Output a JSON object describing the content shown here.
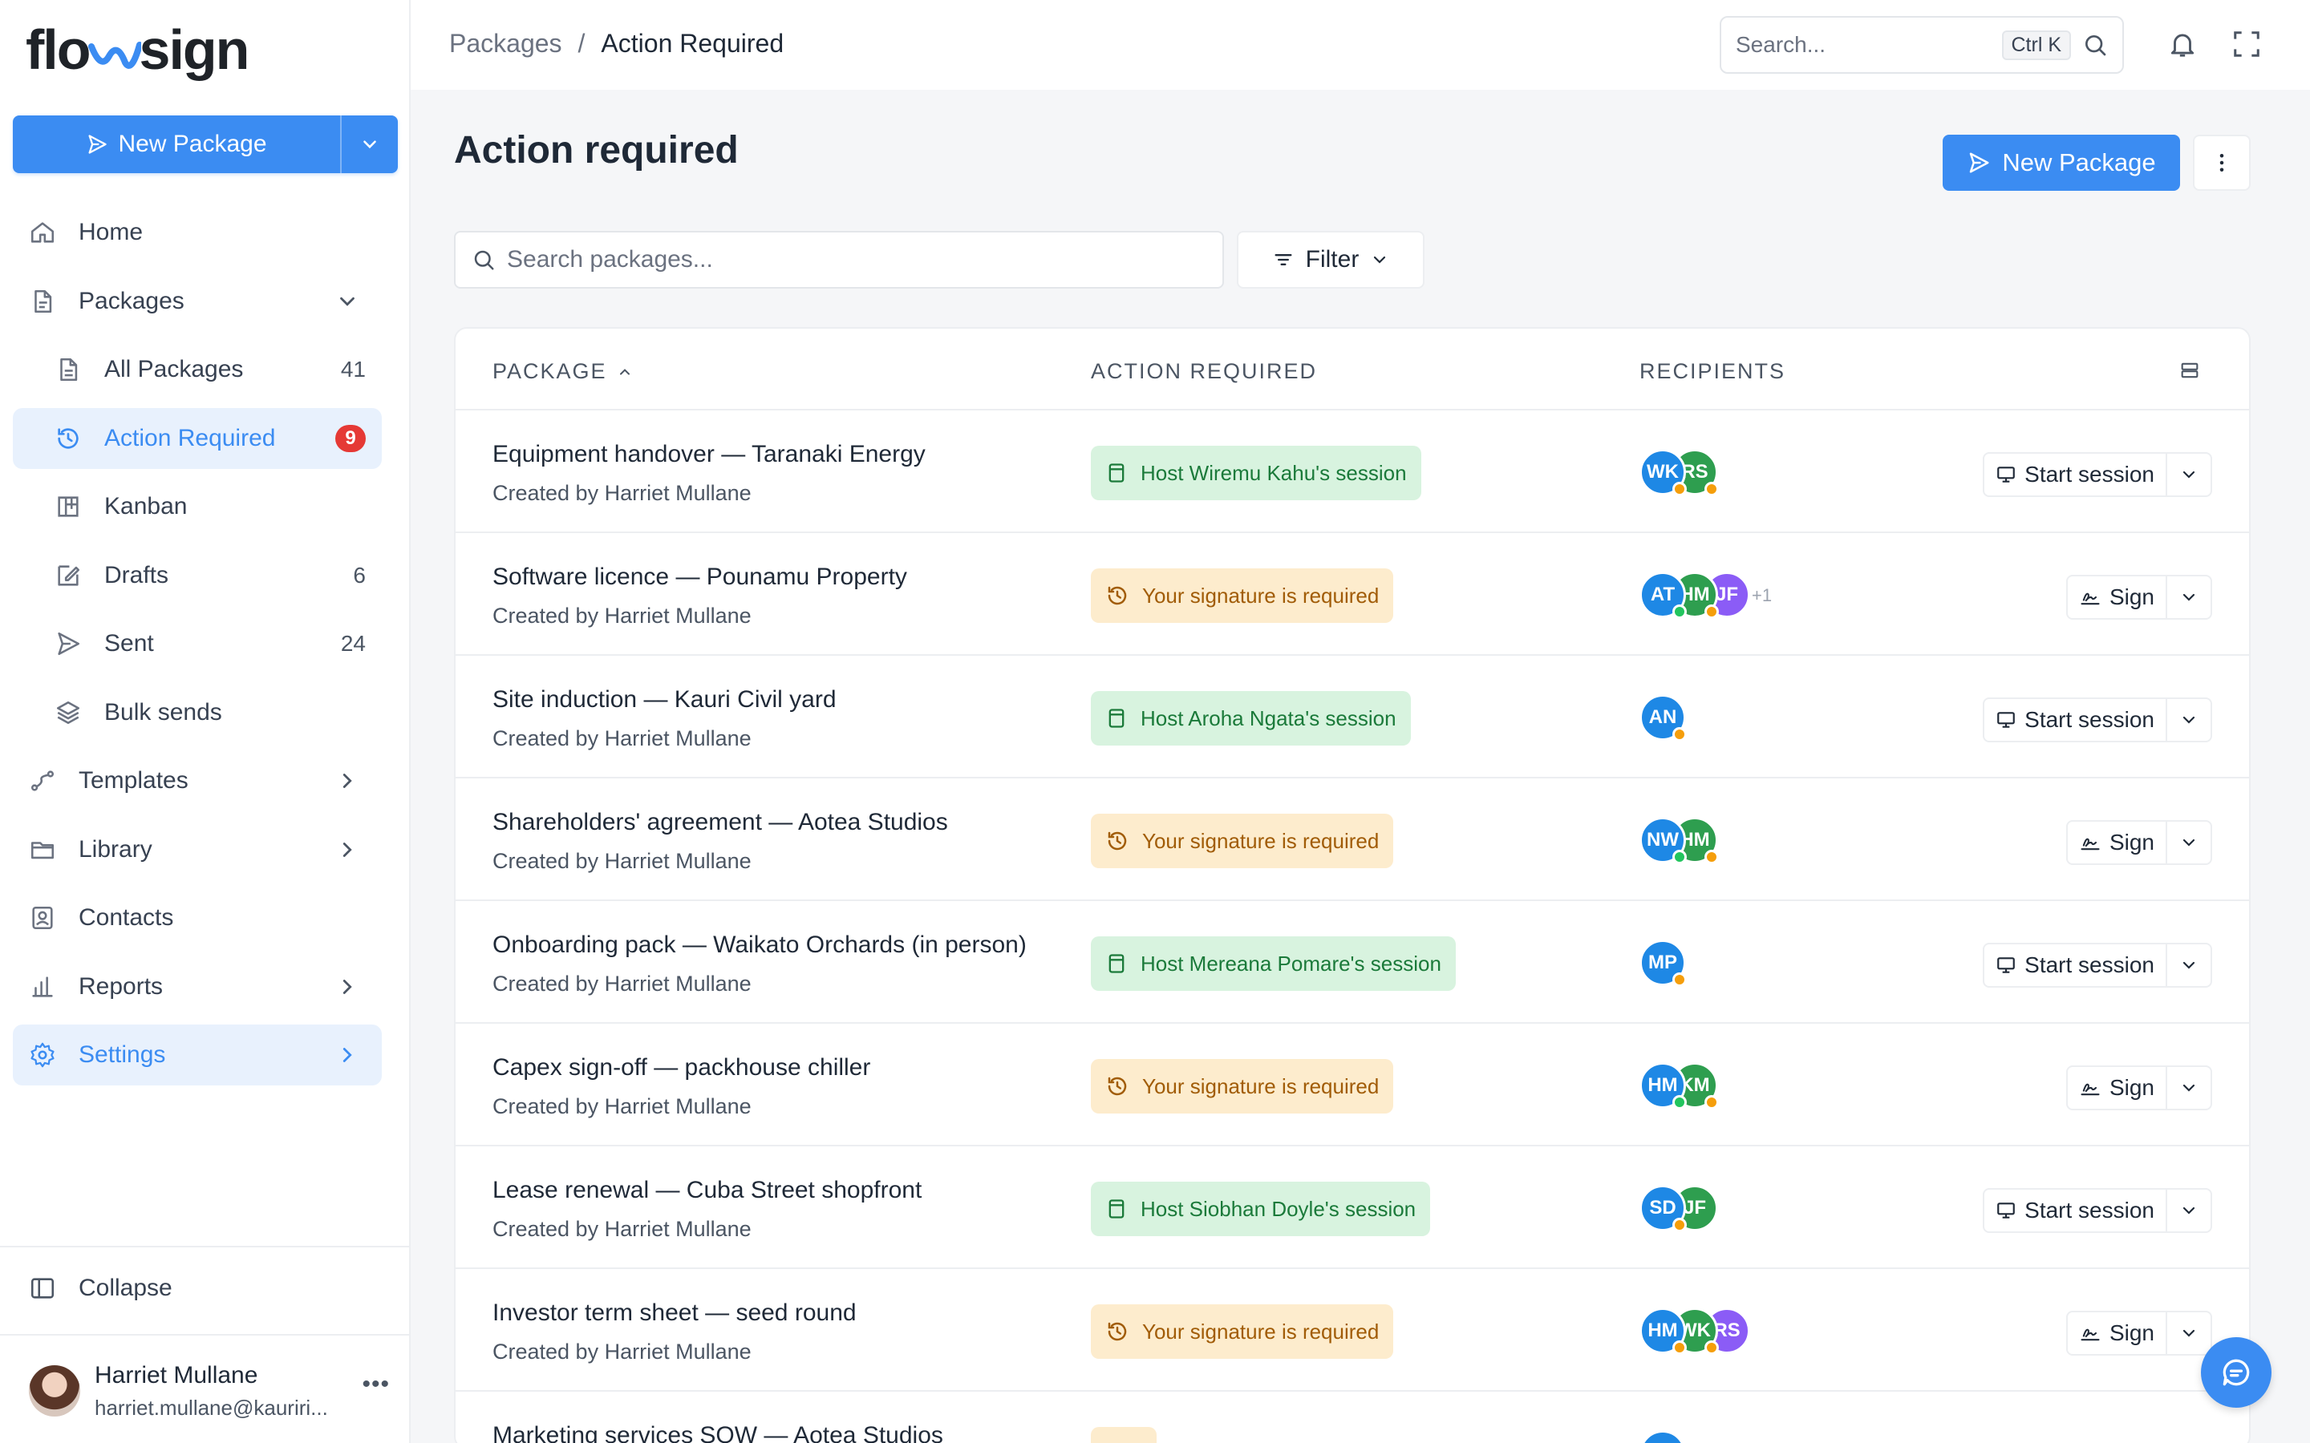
{
  "app": {
    "brand_left": "flo",
    "brand_right": "sign"
  },
  "sidebar": {
    "new_package_label": "New Package",
    "items": [
      {
        "label": "Home",
        "icon": "home-icon"
      },
      {
        "label": "Packages",
        "icon": "document-icon"
      },
      {
        "label": "All Packages",
        "icon": "file-icon",
        "count": "41"
      },
      {
        "label": "Action Required",
        "icon": "history-icon",
        "badge": "9"
      },
      {
        "label": "Kanban",
        "icon": "kanban-icon"
      },
      {
        "label": "Drafts",
        "icon": "edit-icon",
        "count": "6"
      },
      {
        "label": "Sent",
        "icon": "send-icon",
        "count": "24"
      },
      {
        "label": "Bulk sends",
        "icon": "layers-icon"
      },
      {
        "label": "Templates",
        "icon": "route-icon"
      },
      {
        "label": "Library",
        "icon": "folder-icon"
      },
      {
        "label": "Contacts",
        "icon": "contact-icon"
      },
      {
        "label": "Reports",
        "icon": "bar-chart-icon"
      },
      {
        "label": "Settings",
        "icon": "gear-icon"
      }
    ],
    "collapse_label": "Collapse",
    "user": {
      "name": "Harriet Mullane",
      "email": "harriet.mullane@kauriri..."
    }
  },
  "topbar": {
    "breadcrumb": [
      "Packages",
      "Action Required"
    ],
    "search_placeholder": "Search...",
    "search_shortcut": "Ctrl K"
  },
  "main": {
    "title": "Action required",
    "new_package_label": "New Package",
    "search_placeholder": "Search packages...",
    "filter_label": "Filter",
    "columns": [
      "PACKAGE",
      "ACTION REQUIRED",
      "RECIPIENTS"
    ],
    "created_by_prefix": "Created by",
    "rows": [
      {
        "title": "Equipment handover — Taranaki Energy",
        "creator": "Created by Harriet Mullane",
        "action": "Host Wiremu Kahu's session",
        "tone": "green",
        "button": "Start session",
        "recipients": [
          {
            "initials": "WK",
            "color": "#1e88e5",
            "dot": "#f59e0b"
          },
          {
            "initials": "RS",
            "color": "#2e9e4f",
            "dot": "#f59e0b"
          }
        ]
      },
      {
        "title": "Software licence — Pounamu Property",
        "creator": "Created by Harriet Mullane",
        "action": "Your signature is required",
        "tone": "amber",
        "button": "Sign",
        "recipients": [
          {
            "initials": "AT",
            "color": "#1e88e5",
            "dot": "#22c55e"
          },
          {
            "initials": "HM",
            "color": "#2e9e4f",
            "dot": "#f59e0b"
          },
          {
            "initials": "JF",
            "color": "#8b5cf6",
            "dot": ""
          }
        ],
        "more": "+1"
      },
      {
        "title": "Site induction — Kauri Civil yard",
        "creator": "Created by Harriet Mullane",
        "action": "Host Aroha Ngata's session",
        "tone": "green",
        "button": "Start session",
        "recipients": [
          {
            "initials": "AN",
            "color": "#1e88e5",
            "dot": "#f59e0b"
          }
        ]
      },
      {
        "title": "Shareholders' agreement — Aotea Studios",
        "creator": "Created by Harriet Mullane",
        "action": "Your signature is required",
        "tone": "amber",
        "button": "Sign",
        "recipients": [
          {
            "initials": "NW",
            "color": "#1e88e5",
            "dot": "#22c55e"
          },
          {
            "initials": "HM",
            "color": "#2e9e4f",
            "dot": "#f59e0b"
          }
        ]
      },
      {
        "title": "Onboarding pack — Waikato Orchards (in person)",
        "creator": "Created by Harriet Mullane",
        "action": "Host Mereana Pomare's session",
        "tone": "green",
        "button": "Start session",
        "recipients": [
          {
            "initials": "MP",
            "color": "#1e88e5",
            "dot": "#f59e0b"
          }
        ]
      },
      {
        "title": "Capex sign-off — packhouse chiller",
        "creator": "Created by Harriet Mullane",
        "action": "Your signature is required",
        "tone": "amber",
        "button": "Sign",
        "recipients": [
          {
            "initials": "HM",
            "color": "#1e88e5",
            "dot": "#22c55e"
          },
          {
            "initials": "KM",
            "color": "#2e9e4f",
            "dot": "#f59e0b"
          }
        ]
      },
      {
        "title": "Lease renewal — Cuba Street shopfront",
        "creator": "Created by Harriet Mullane",
        "action": "Host Siobhan Doyle's session",
        "tone": "green",
        "button": "Start session",
        "recipients": [
          {
            "initials": "SD",
            "color": "#1e88e5",
            "dot": "#f59e0b"
          },
          {
            "initials": "JF",
            "color": "#2e9e4f",
            "dot": ""
          }
        ]
      },
      {
        "title": "Investor term sheet — seed round",
        "creator": "Created by Harriet Mullane",
        "action": "Your signature is required",
        "tone": "amber",
        "button": "Sign",
        "recipients": [
          {
            "initials": "HM",
            "color": "#1e88e5",
            "dot": "#f59e0b"
          },
          {
            "initials": "WK",
            "color": "#2e9e4f",
            "dot": "#f59e0b"
          },
          {
            "initials": "RS",
            "color": "#8b5cf6",
            "dot": ""
          }
        ]
      },
      {
        "title": "Marketing services SOW — Aotea Studios",
        "creator": "",
        "action": "",
        "tone": "amber",
        "button": "",
        "recipients": [
          {
            "initials": "",
            "color": "#1e88e5",
            "dot": ""
          }
        ]
      }
    ]
  },
  "colors": {
    "accent": "#3b8cf2",
    "badge": "#e53935",
    "green_bg": "#d8f3df",
    "amber_bg": "#fdeccd"
  }
}
